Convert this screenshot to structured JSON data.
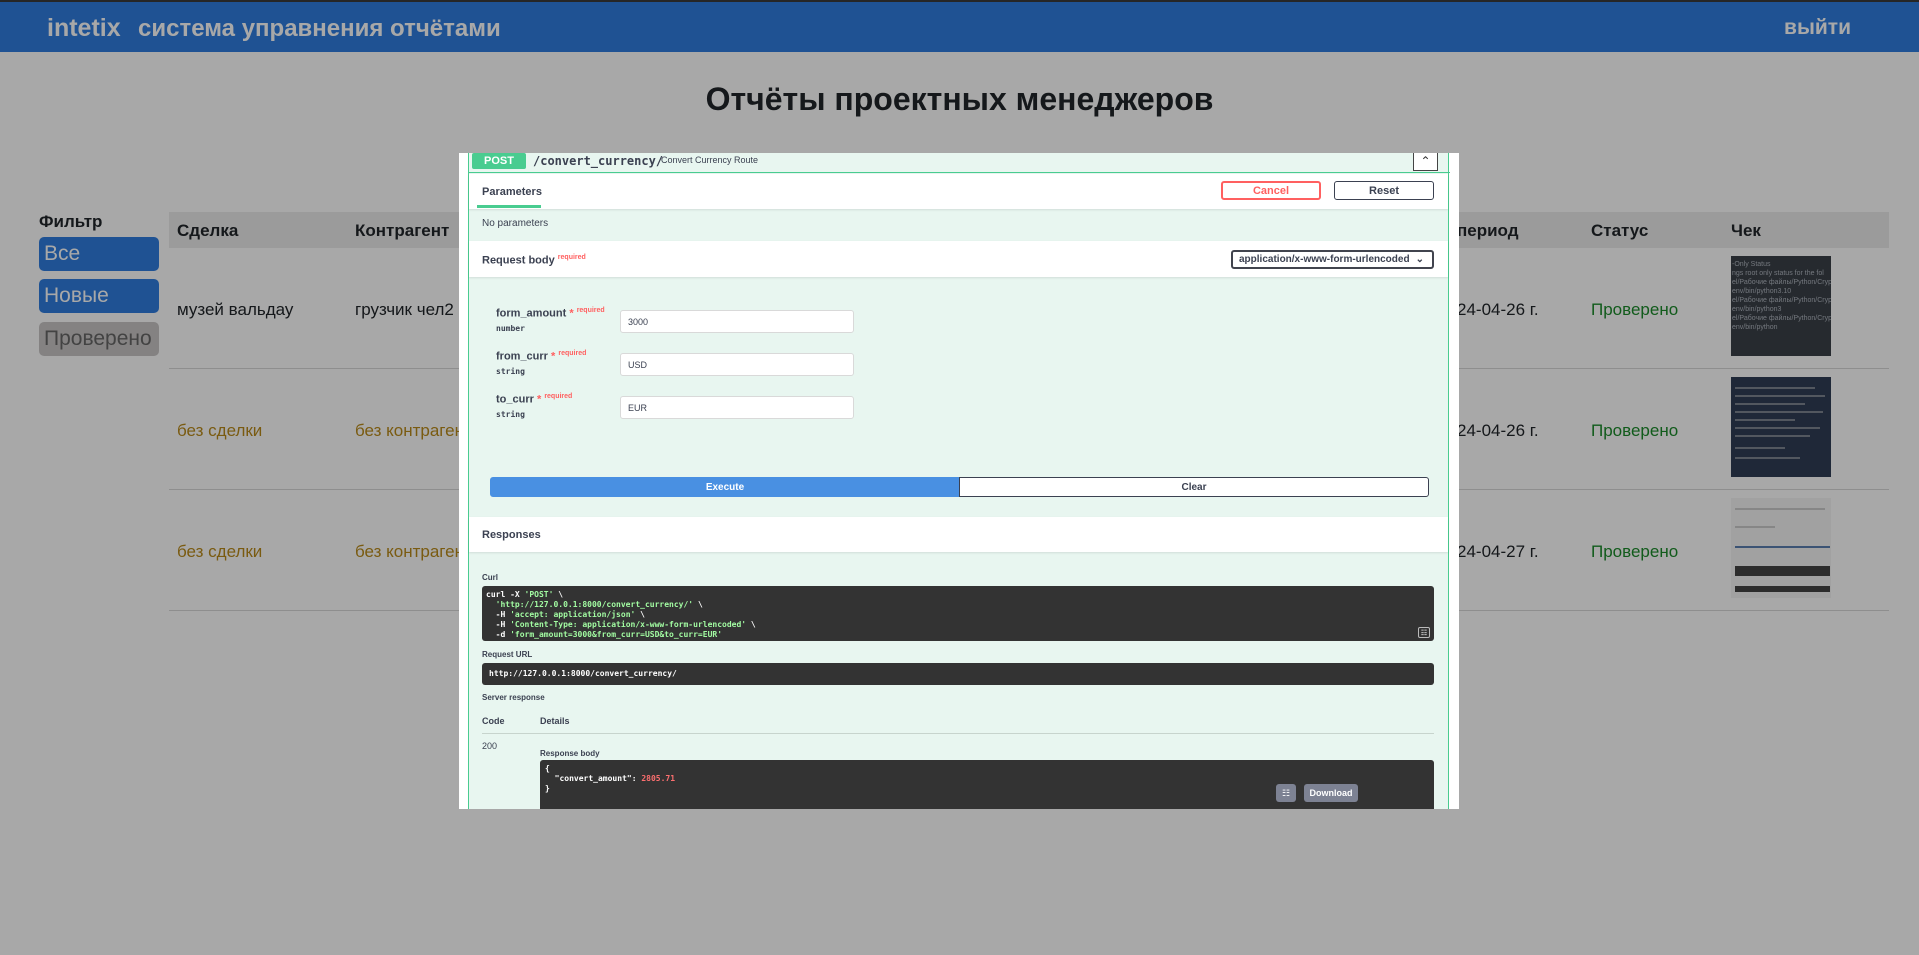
{
  "header": {
    "brand": "intetix",
    "system_title": "система управнения отчётами",
    "logout_label": "выйти"
  },
  "page_title": "Отчёты проектных менеджеров",
  "filter": {
    "label": "Фильтр",
    "buttons": [
      "Все",
      "Новые",
      "Проверено"
    ]
  },
  "table": {
    "columns": [
      "Сделка",
      "Контрагент",
      "период",
      "Статус",
      "Чек"
    ],
    "rows": [
      {
        "deal": "музей вальдау",
        "counterparty": "грузчик чел2",
        "period": "24-04-26 г.",
        "status": "Проверено"
      },
      {
        "deal": "без сделки",
        "counterparty": "без контрагента",
        "period": "24-04-26 г.",
        "status": "Проверено"
      },
      {
        "deal": "без сделки",
        "counterparty": "без контрагента",
        "period": "24-04-27 г.",
        "status": "Проверено"
      }
    ],
    "receipt_thumb_text": "-Only Status\nngs root only status for the fol\nel/Рабочие файлы/Python/Cryp\nenv/bin/python3.10\nel/Рабочие файлы/Python/Cryp\nenv/bin/python3\nel/Рабочие файлы/Python/Cryp\nenv/bin/python"
  },
  "swagger": {
    "method": "POST",
    "path": "/convert_currency/",
    "summary": "Convert Currency Route",
    "parameters_tab": "Parameters",
    "cancel_label": "Cancel",
    "reset_label": "Reset",
    "no_parameters": "No parameters",
    "request_body_label": "Request body",
    "required_label": "required",
    "content_type": "application/x-www-form-urlencoded",
    "fields": [
      {
        "name": "form_amount",
        "type": "number",
        "value": "3000"
      },
      {
        "name": "from_curr",
        "type": "string",
        "value": "USD"
      },
      {
        "name": "to_curr",
        "type": "string",
        "value": "EUR"
      }
    ],
    "execute_label": "Execute",
    "clear_label": "Clear",
    "responses_label": "Responses",
    "curl_label": "Curl",
    "curl_lines": [
      {
        "pre": "curl -X ",
        "str": "'POST'",
        "post": " \\"
      },
      {
        "pre": "  ",
        "str": "'http://127.0.0.1:8000/convert_currency/'",
        "post": " \\"
      },
      {
        "pre": "  -H ",
        "str": "'accept: application/json'",
        "post": " \\"
      },
      {
        "pre": "  -H ",
        "str": "'Content-Type: application/x-www-form-urlencoded'",
        "post": " \\"
      },
      {
        "pre": "  -d ",
        "str": "'form_amount=3000&from_curr=USD&to_curr=EUR'",
        "post": ""
      }
    ],
    "request_url_label": "Request URL",
    "request_url": "http://127.0.0.1:8000/convert_currency/",
    "server_response_label": "Server response",
    "code_col": "Code",
    "details_col": "Details",
    "response_code": "200",
    "response_body_label": "Response body",
    "response_body": {
      "open": "{",
      "key": "  \"convert_amount\": ",
      "value": "2805.71",
      "close": "}"
    },
    "download_label": "Download"
  }
}
